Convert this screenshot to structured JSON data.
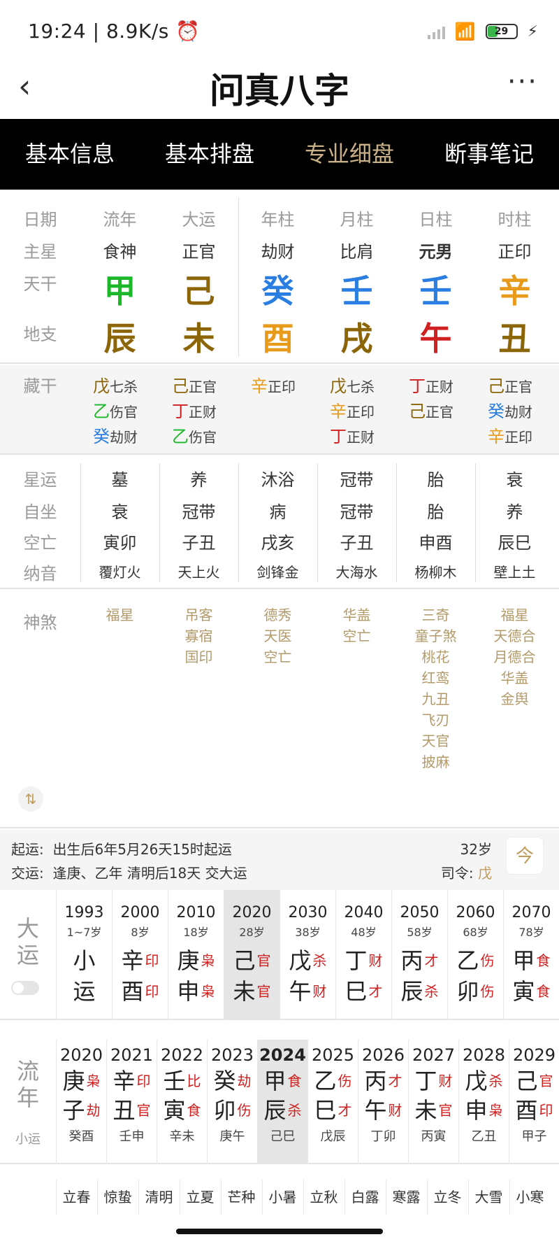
{
  "status": {
    "time": "19:24",
    "speed": "8.9K/s",
    "battery": "29"
  },
  "app": {
    "title": "问真八字",
    "back": "‹",
    "more": "···"
  },
  "tabs": [
    {
      "label": "基本信息",
      "active": false
    },
    {
      "label": "基本排盘",
      "active": false
    },
    {
      "label": "专业细盘",
      "active": true
    },
    {
      "label": "断事笔记",
      "active": false
    }
  ],
  "row_labels": {
    "date": "日期",
    "main_star": "主星",
    "tiangan": "天干",
    "dizhi": "地支",
    "canggan": "藏干",
    "xingyun": "星运",
    "zizuo": "自坐",
    "kongwang": "空亡",
    "nayin": "纳音",
    "shensha": "神煞"
  },
  "pillars": [
    {
      "header": "流年",
      "star": "食神",
      "gan": "甲",
      "gan_color": "#1db82a",
      "zhi": "辰",
      "zhi_color": "#8b6508",
      "hidden": [
        {
          "g": "戊",
          "c": "#8b6508",
          "t": "七杀"
        },
        {
          "g": "乙",
          "c": "#1db82a",
          "t": "伤官"
        },
        {
          "g": "癸",
          "c": "#2a7de1",
          "t": "劫财"
        }
      ],
      "xingyun": "墓",
      "zizuo": "衰",
      "kongwang": "寅卯",
      "nayin": "覆灯火",
      "shensha": [
        "福星"
      ]
    },
    {
      "header": "大运",
      "star": "正官",
      "gan": "己",
      "gan_color": "#8b6508",
      "zhi": "未",
      "zhi_color": "#8b6508",
      "hidden": [
        {
          "g": "己",
          "c": "#8b6508",
          "t": "正官"
        },
        {
          "g": "丁",
          "c": "#d02020",
          "t": "正财"
        },
        {
          "g": "乙",
          "c": "#1db82a",
          "t": "伤官"
        }
      ],
      "xingyun": "养",
      "zizuo": "冠带",
      "kongwang": "子丑",
      "nayin": "天上火",
      "shensha": [
        "吊客",
        "寡宿",
        "国印"
      ]
    },
    {
      "header": "年柱",
      "star": "劫财",
      "gan": "癸",
      "gan_color": "#2a7de1",
      "zhi": "酉",
      "zhi_color": "#e89a1a",
      "hidden": [
        {
          "g": "辛",
          "c": "#e89a1a",
          "t": "正印"
        }
      ],
      "xingyun": "沐浴",
      "zizuo": "病",
      "kongwang": "戌亥",
      "nayin": "剑锋金",
      "shensha": [
        "德秀",
        "天医",
        "空亡"
      ]
    },
    {
      "header": "月柱",
      "star": "比肩",
      "gan": "壬",
      "gan_color": "#2a7de1",
      "zhi": "戌",
      "zhi_color": "#8b6508",
      "hidden": [
        {
          "g": "戊",
          "c": "#8b6508",
          "t": "七杀"
        },
        {
          "g": "辛",
          "c": "#e89a1a",
          "t": "正印"
        },
        {
          "g": "丁",
          "c": "#d02020",
          "t": "正财"
        }
      ],
      "xingyun": "冠带",
      "zizuo": "冠带",
      "kongwang": "子丑",
      "nayin": "大海水",
      "shensha": [
        "华盖",
        "空亡"
      ]
    },
    {
      "header": "日柱",
      "star": "元男",
      "gan": "壬",
      "gan_color": "#2a7de1",
      "zhi": "午",
      "zhi_color": "#d02020",
      "hidden": [
        {
          "g": "丁",
          "c": "#d02020",
          "t": "正财"
        },
        {
          "g": "己",
          "c": "#8b6508",
          "t": "正官"
        }
      ],
      "xingyun": "胎",
      "zizuo": "胎",
      "kongwang": "申酉",
      "nayin": "杨柳木",
      "shensha": [
        "三奇",
        "童子煞",
        "桃花",
        "红鸾",
        "九丑",
        "飞刃",
        "天官",
        "披麻"
      ]
    },
    {
      "header": "时柱",
      "star": "正印",
      "gan": "辛",
      "gan_color": "#e89a1a",
      "zhi": "丑",
      "zhi_color": "#8b6508",
      "hidden": [
        {
          "g": "己",
          "c": "#8b6508",
          "t": "正官"
        },
        {
          "g": "癸",
          "c": "#2a7de1",
          "t": "劫财"
        },
        {
          "g": "辛",
          "c": "#e89a1a",
          "t": "正印"
        }
      ],
      "xingyun": "衰",
      "zizuo": "养",
      "kongwang": "辰巳",
      "nayin": "壁上土",
      "shensha": [
        "福星",
        "天德合",
        "月德合",
        "华盖",
        "金舆"
      ]
    }
  ],
  "qiyun": {
    "qiyun_label": "起运:",
    "qiyun_text": "出生后6年5月26天15时起运",
    "jiaoyun_label": "交运:",
    "jiaoyun_text": "逢庚、乙年 清明后18天 交大运",
    "age": "32岁",
    "siling_label": "司令:",
    "siling_value": "戊",
    "cal_icon": "今"
  },
  "dayun": {
    "label": "大运",
    "items": [
      {
        "year": "1993",
        "age": "1~7岁",
        "g": "小",
        "gs": "",
        "z": "运",
        "zs": "",
        "hl": false
      },
      {
        "year": "2000",
        "age": "8岁",
        "g": "辛",
        "gs": "印",
        "z": "酉",
        "zs": "印",
        "hl": false
      },
      {
        "year": "2010",
        "age": "18岁",
        "g": "庚",
        "gs": "枭",
        "z": "申",
        "zs": "枭",
        "hl": false
      },
      {
        "year": "2020",
        "age": "28岁",
        "g": "己",
        "gs": "官",
        "z": "未",
        "zs": "官",
        "hl": true
      },
      {
        "year": "2030",
        "age": "38岁",
        "g": "戊",
        "gs": "杀",
        "z": "午",
        "zs": "财",
        "hl": false
      },
      {
        "year": "2040",
        "age": "48岁",
        "g": "丁",
        "gs": "财",
        "z": "巳",
        "zs": "才",
        "hl": false
      },
      {
        "year": "2050",
        "age": "58岁",
        "g": "丙",
        "gs": "才",
        "z": "辰",
        "zs": "杀",
        "hl": false
      },
      {
        "year": "2060",
        "age": "68岁",
        "g": "乙",
        "gs": "伤",
        "z": "卯",
        "zs": "伤",
        "hl": false
      },
      {
        "year": "2070",
        "age": "78岁",
        "g": "甲",
        "gs": "食",
        "z": "寅",
        "zs": "食",
        "hl": false
      }
    ]
  },
  "liunian": {
    "label": "流年",
    "sublabel": "小运",
    "items": [
      {
        "year": "2020",
        "g": "庚",
        "gs": "枭",
        "z": "子",
        "zs": "劫",
        "xy": "癸酉",
        "hl": false
      },
      {
        "year": "2021",
        "g": "辛",
        "gs": "印",
        "z": "丑",
        "zs": "官",
        "xy": "壬申",
        "hl": false
      },
      {
        "year": "2022",
        "g": "壬",
        "gs": "比",
        "z": "寅",
        "zs": "食",
        "xy": "辛未",
        "hl": false
      },
      {
        "year": "2023",
        "g": "癸",
        "gs": "劫",
        "z": "卯",
        "zs": "伤",
        "xy": "庚午",
        "hl": false
      },
      {
        "year": "2024",
        "g": "甲",
        "gs": "食",
        "z": "辰",
        "zs": "杀",
        "xy": "己巳",
        "hl": true
      },
      {
        "year": "2025",
        "g": "乙",
        "gs": "伤",
        "z": "巳",
        "zs": "才",
        "xy": "戊辰",
        "hl": false
      },
      {
        "year": "2026",
        "g": "丙",
        "gs": "才",
        "z": "午",
        "zs": "财",
        "xy": "丁卯",
        "hl": false
      },
      {
        "year": "2027",
        "g": "丁",
        "gs": "财",
        "z": "未",
        "zs": "官",
        "xy": "丙寅",
        "hl": false
      },
      {
        "year": "2028",
        "g": "戊",
        "gs": "杀",
        "z": "申",
        "zs": "枭",
        "xy": "乙丑",
        "hl": false
      },
      {
        "year": "2029",
        "g": "己",
        "gs": "官",
        "z": "酉",
        "zs": "印",
        "xy": "甲子",
        "hl": false
      }
    ]
  },
  "jieqi": [
    "立春",
    "惊蛰",
    "清明",
    "立夏",
    "芒种",
    "小暑",
    "立秋",
    "白露",
    "寒露",
    "立冬",
    "大雪",
    "小寒"
  ],
  "sort_icon": "⇅",
  "colors": {
    "tab_bg": "#000000",
    "tab_active": "#c9b089",
    "shensha": "#b39a6b",
    "shishen_red": "#d02020",
    "highlight": "#e5e5e5"
  }
}
